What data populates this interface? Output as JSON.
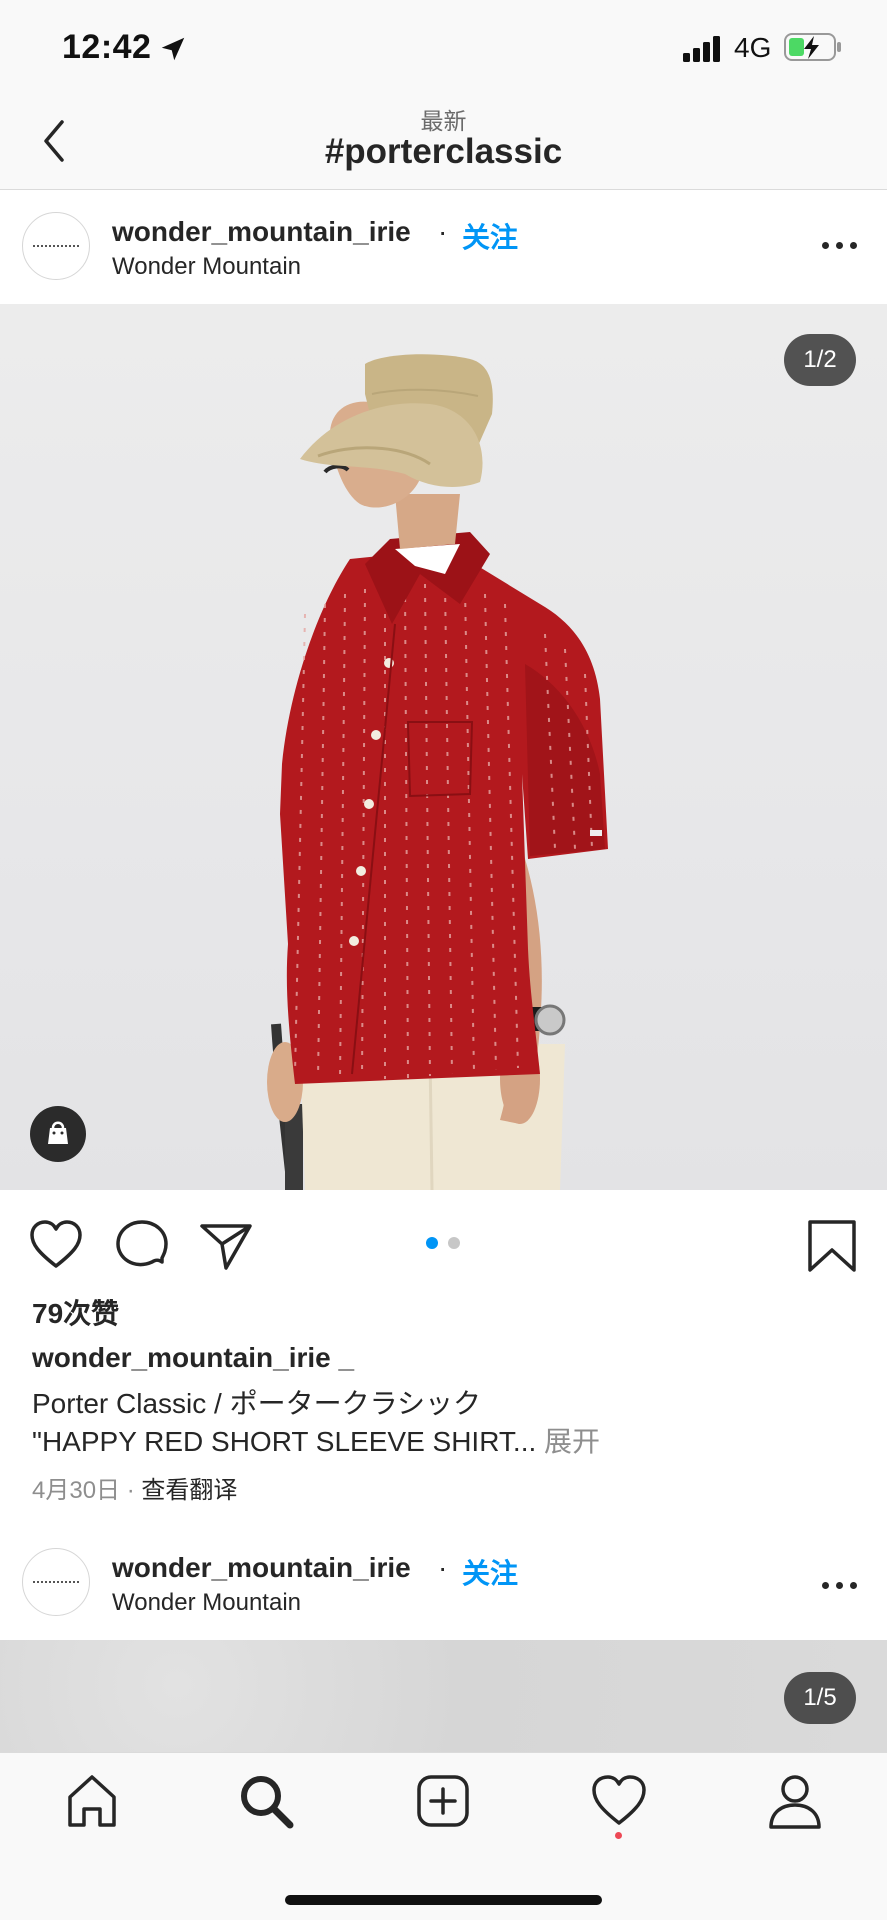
{
  "status_bar": {
    "time": "12:42",
    "network": "4G",
    "icons": [
      "location-arrow-icon",
      "signal-icon",
      "battery-charging-icon"
    ]
  },
  "nav": {
    "subtitle": "最新",
    "title": "#porterclassic",
    "back_icon": "chevron-left-icon"
  },
  "posts": [
    {
      "username": "wonder_mountain_irie",
      "separator": "·",
      "follow_label": "关注",
      "location": "Wonder Mountain",
      "more_icon": "ellipsis-icon",
      "media_counter": "1/2",
      "likes": "79次赞",
      "caption": {
        "username": "wonder_mountain_irie _",
        "line1": "Porter Classic / ポータークラシック",
        "line2": "\"HAPPY RED SHORT SLEEVE SHIRT...",
        "more": "展开"
      },
      "date": "4月30日",
      "meta_sep": "·",
      "translate_label": "查看翻译",
      "carousel": {
        "count": 2,
        "active": 1
      }
    },
    {
      "username": "wonder_mountain_irie",
      "separator": "·",
      "follow_label": "关注",
      "location": "Wonder Mountain",
      "more_icon": "ellipsis-icon",
      "media_counter": "1/5"
    }
  ],
  "tabs": [
    {
      "name": "home",
      "icon": "home-icon",
      "active": false
    },
    {
      "name": "search",
      "icon": "search-icon",
      "active": true
    },
    {
      "name": "new-post",
      "icon": "plus-square-icon",
      "active": false
    },
    {
      "name": "activity",
      "icon": "heart-icon",
      "active": false,
      "has_notification": true
    },
    {
      "name": "profile",
      "icon": "person-icon",
      "active": false
    }
  ],
  "colors": {
    "accent": "#0095f6",
    "text": "#262626",
    "muted": "#8e8e8e",
    "shirt": "#b3191e",
    "hat": "#cbb88c",
    "notification": "#ed4956"
  }
}
